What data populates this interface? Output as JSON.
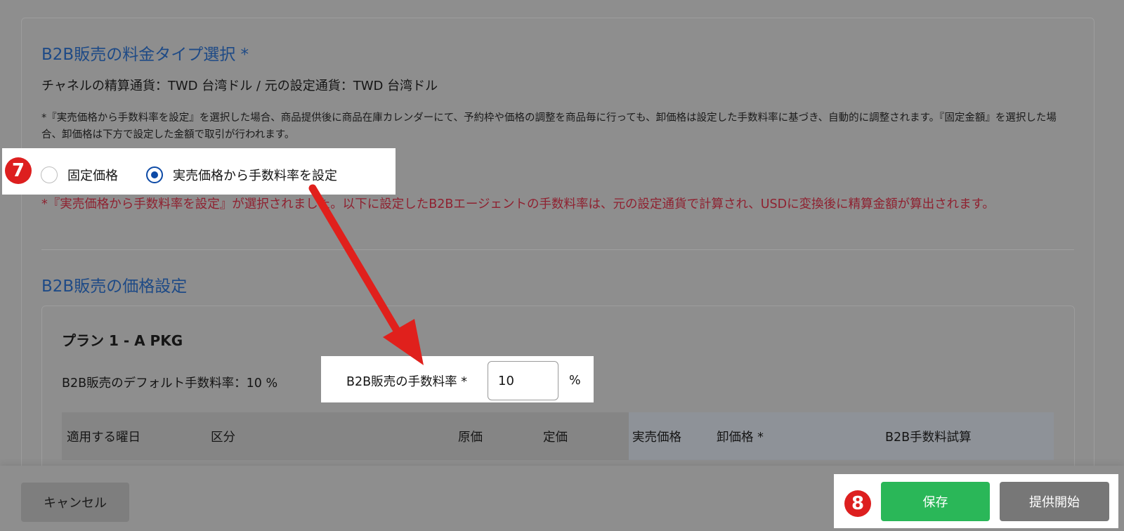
{
  "pricing_type": {
    "title": "B2B販売の料金タイプ選択 *",
    "currency_info": "チャネルの精算通貨：TWD 台湾ドル / 元の設定通貨：TWD 台湾ドル",
    "note": "*『実売価格から手数料率を設定』を選択した場合、商品提供後に商品在庫カレンダーにて、予約枠や価格の調整を商品毎に行っても、卸価格は設定した手数料率に基づき、自動的に調整されます。『固定金額』を選択した場合、卸価格は下方で設定した金額で取引が行われます。",
    "options": [
      {
        "label": "固定価格",
        "selected": false
      },
      {
        "label": "実売価格から手数料率を設定",
        "selected": true
      }
    ],
    "warning": "*『実売価格から手数料率を設定』が選択されました。以下に設定したB2Bエージェントの手数料率は、元の設定通貨で計算され、USDに変換後に精算金額が算出されます。"
  },
  "price_settings": {
    "title": "B2B販売の価格設定",
    "plan_title": "プラン 1 - A PKG",
    "default_rate": "B2B販売のデフォルト手数料率：10 %",
    "rate_label": "B2B販売の手数料率 *",
    "rate_value": "10",
    "rate_unit": "%",
    "columns": [
      "適用する曜日",
      "区分",
      "原価",
      "定価",
      "実売価格",
      "卸価格 *",
      "B2B手数料試算"
    ]
  },
  "footer": {
    "cancel": "キャンセル",
    "save": "保存",
    "start": "提供開始"
  },
  "annotations": {
    "step7": "7",
    "step8": "8",
    "badge_color": "#dd1f1f",
    "arrow_color": "#e0201c"
  },
  "colors": {
    "title_blue": "#1e4a86",
    "warning_red": "#8f2130",
    "save_green": "#2ab758",
    "radio_blue": "#0d4aa6"
  }
}
